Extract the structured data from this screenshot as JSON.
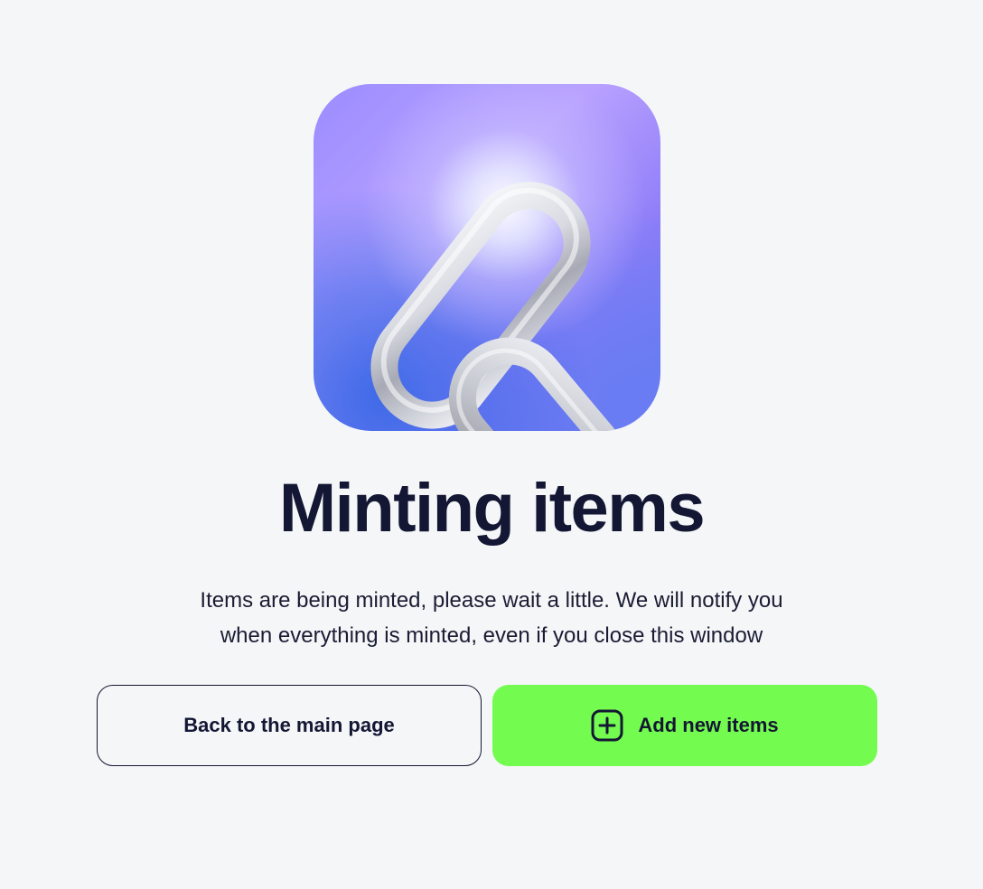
{
  "title": "Minting items",
  "description": {
    "line1": "Items are being minted, please wait a little. We will notify you",
    "line2": "when everything is minted, even if you close this window"
  },
  "buttons": {
    "back_label": "Back to the main page",
    "add_label": "Add new items"
  },
  "icons": {
    "hero": "chain-link-icon",
    "add": "plus-square-icon"
  },
  "colors": {
    "background": "#f5f6f8",
    "text": "#131733",
    "accent": "#74fb4f"
  }
}
